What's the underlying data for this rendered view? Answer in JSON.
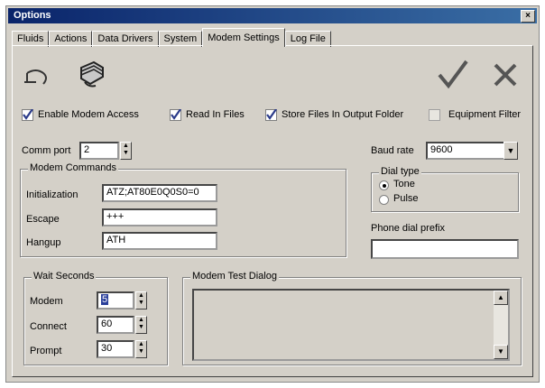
{
  "window": {
    "title": "Options",
    "close_glyph": "×"
  },
  "tabs": [
    {
      "label": "Fluids"
    },
    {
      "label": "Actions"
    },
    {
      "label": "Data Drivers"
    },
    {
      "label": "System"
    },
    {
      "label": "Modem Settings"
    },
    {
      "label": "Log File"
    }
  ],
  "active_tab": "Modem Settings",
  "toolbar": {
    "undo_icon": "undo-icon",
    "modem_icon": "modem-icon",
    "ok_icon": "checkmark-icon",
    "cancel_icon": "x-icon"
  },
  "checkboxes": [
    {
      "label": "Enable Modem Access",
      "checked": true
    },
    {
      "label": "Read In Files",
      "checked": true
    },
    {
      "label": "Store Files In Output Folder",
      "checked": true
    },
    {
      "label": "Equipment Filter",
      "checked": false
    }
  ],
  "comm_port": {
    "label": "Comm port",
    "value": "2"
  },
  "baud_rate": {
    "label": "Baud rate",
    "value": "9600"
  },
  "modem_commands": {
    "title": "Modem Commands",
    "initialization": {
      "label": "Initialization",
      "value": "ATZ;AT80E0Q0S0=0"
    },
    "escape": {
      "label": "Escape",
      "value": "+++"
    },
    "hangup": {
      "label": "Hangup",
      "value": "ATH"
    }
  },
  "dial_type": {
    "title": "Dial type",
    "options": [
      {
        "label": "Tone",
        "selected": true
      },
      {
        "label": "Pulse",
        "selected": false
      }
    ]
  },
  "phone_dial_prefix": {
    "label": "Phone dial prefix",
    "value": ""
  },
  "wait_seconds": {
    "title": "Wait Seconds",
    "modem": {
      "label": "Modem",
      "value": "5"
    },
    "connect": {
      "label": "Connect",
      "value": "60"
    },
    "prompt": {
      "label": "Prompt",
      "value": "30"
    }
  },
  "modem_test_dialog": {
    "title": "Modem Test Dialog"
  }
}
